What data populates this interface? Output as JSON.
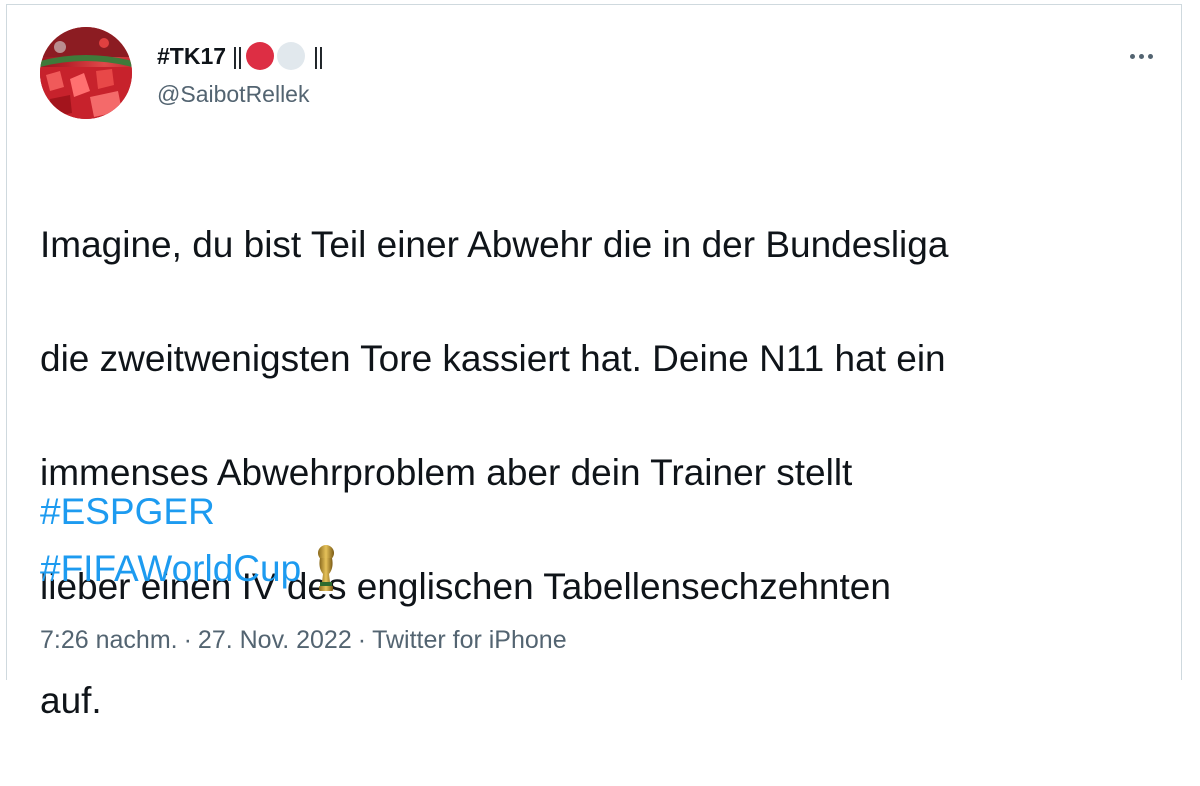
{
  "tweet": {
    "author": {
      "display_name": "#TK17",
      "name_bars_start": "||",
      "name_bars_end": "||",
      "handle": "@SaibotRellek",
      "avatar_icon": "avatar-stadium-fans"
    },
    "more_icon": "more-dots-icon",
    "text_lines": [
      "Imagine, du bist Teil einer Abwehr die in der Bundesliga",
      "die zweitwenigsten Tore kassiert hat. Deine N11 hat ein",
      "immenses Abwehrproblem aber dein Trainer stellt",
      "lieber einen IV des englischen Tabellensechzehnten",
      "auf."
    ],
    "hashtags": [
      "#ESPGER",
      "#FIFAWorldCup"
    ],
    "trophy_icon": "world-cup-trophy-icon",
    "meta": {
      "time": "7:26 nachm.",
      "separator": "·",
      "date": "27. Nov. 2022",
      "source": "Twitter for iPhone"
    },
    "colors": {
      "hashtag": "#1d9bf0",
      "secondary_text": "#536471",
      "red_dot": "#dd2e44",
      "white_dot": "#e1e8ed"
    }
  }
}
